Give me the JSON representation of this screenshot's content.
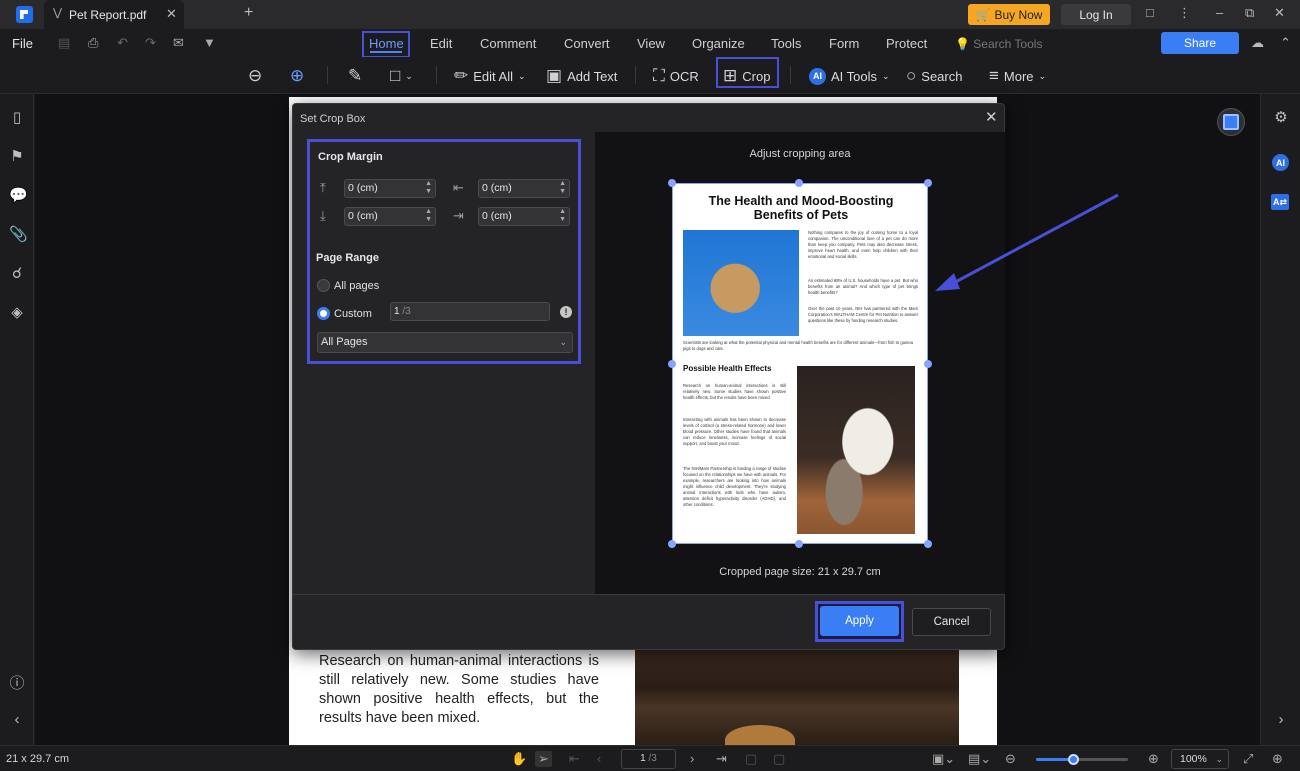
{
  "titlebar": {
    "tab_title": "Pet Report.pdf",
    "buy_now_label": "Buy Now",
    "log_in_label": "Log In"
  },
  "menubar": {
    "file": "File",
    "tabs": [
      "Home",
      "Edit",
      "Comment",
      "Convert",
      "View",
      "Organize",
      "Tools",
      "Form",
      "Protect"
    ],
    "active_tab": "Home",
    "search_tools_placeholder": "Search Tools",
    "share_label": "Share"
  },
  "toolbar": {
    "edit_all": "Edit All",
    "add_text": "Add Text",
    "ocr": "OCR",
    "crop": "Crop",
    "ai_badge": "AI",
    "ai_tools": "AI Tools",
    "search": "Search",
    "more": "More"
  },
  "dialog": {
    "title": "Set Crop Box",
    "crop_margin_heading": "Crop Margin",
    "margins": {
      "top": "0 (cm)",
      "left": "0 (cm)",
      "bottom": "0 (cm)",
      "right": "0 (cm)"
    },
    "page_range_heading": "Page Range",
    "all_pages_radio": "All pages",
    "custom_radio": "Custom",
    "custom_selected": true,
    "custom_value": "1",
    "custom_total": "/3",
    "pages_select_value": "All Pages",
    "preview_caption": "Adjust cropping area",
    "cropped_size": "Cropped page size: 21 x 29.7 cm",
    "apply_label": "Apply",
    "cancel_label": "Cancel"
  },
  "thumbnail": {
    "title_line1": "The Health and Mood-Boosting",
    "title_line2": "Benefits of Pets",
    "intro_p1": "Nothing compares to the joy of coming home to a loyal companion. The unconditional love of a pet can do more than keep you company. Pets may also decrease stress, improve heart health, and even help children with their emotional and social skills.",
    "intro_p2": "An estimated 68% of U.S. households have a pet. But who benefits from an animal? And which type of pet brings health benefits?",
    "intro_p3": "Over the past 10 years, NIH has partnered with the Mars Corporation's WALTHAM Centre for Pet Nutrition to answer questions like these by funding research studies.",
    "scientists": "Scientists are looking at what the potential physical and mental health benefits are for different animals—from fish to guinea pigs to dogs and cats.",
    "effects_heading": "Possible Health Effects",
    "effects_p1": "Research on human-animal interactions is still relatively new. Some studies have shown positive health effects, but the results have been mixed.",
    "effects_p2": "Interacting with animals has been shown to decrease levels of cortisol (a stress-related hormone) and lower blood pressure. Other studies have found that animals can reduce loneliness, increase feelings of social support, and boost your mood.",
    "effects_p3": "The NIH/Mars Partnership is funding a range of studies focused on the relationships we have with animals. For example, researchers are looking into how animals might influence child development. They're studying animal interactions with kids who have autism, attention deficit hyperactivity disorder (ADHD), and other conditions."
  },
  "page_behind": {
    "paragraph": "Research on human-animal interactions is still relatively new. Some studies have shown positive health effects, but the results have been mixed."
  },
  "statusbar": {
    "page_size": "21 x 29.7 cm",
    "current_page": "1",
    "total_pages": "/3",
    "zoom_value": "100%",
    "zoom_slider_fraction": 0.4
  },
  "colors": {
    "accent": "#3a7ef5",
    "highlight_box": "#4a4fd8",
    "buy_now": "#f5a623"
  }
}
